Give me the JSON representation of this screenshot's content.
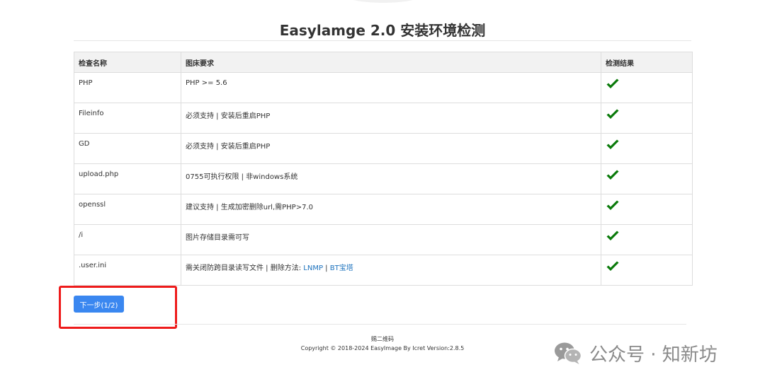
{
  "page": {
    "title": "Easylamge 2.0 安装环境检测"
  },
  "table": {
    "headers": [
      "检查名称",
      "图床要求",
      "检测结果"
    ],
    "rows": [
      {
        "name": "PHP",
        "requirement": "PHP >= 5.6",
        "result": "check-icon"
      },
      {
        "name": "Fileinfo",
        "requirement": "必须支持 | 安装后重启PHP",
        "result": "check-icon"
      },
      {
        "name": "GD",
        "requirement": "必须支持 | 安装后重启PHP",
        "result": "check-icon"
      },
      {
        "name": "upload.php",
        "requirement": "0755可执行权限 | 非windows系统",
        "result": "check-icon"
      },
      {
        "name": "openssl",
        "requirement": "建议支持 | 生成加密删除url,需PHP>7.0",
        "result": "check-icon"
      },
      {
        "name": "/i",
        "requirement": "图片存储目录需可写",
        "result": "check-icon"
      },
      {
        "name": ".user.ini",
        "requirement_text": "需关闭防跨目录读写文件 | 删除方法: ",
        "link1": "LNMP",
        "separator": " | ",
        "link2": "BT宝塔",
        "result": "check-icon"
      }
    ]
  },
  "actions": {
    "next_label": "下一步(1/2)"
  },
  "footer": {
    "qr_text": "赐二维码",
    "copyright": "Copyright © 2018-2024 EasyImage By Icret Version:2.8.5"
  },
  "watermark": {
    "text": "公众号 · 知新坊",
    "icon": "wechat-icon"
  },
  "colors": {
    "check": "#0a7a0a",
    "button": "#3a87f0",
    "highlight": "#ee1b1b",
    "link": "#1e73be"
  }
}
